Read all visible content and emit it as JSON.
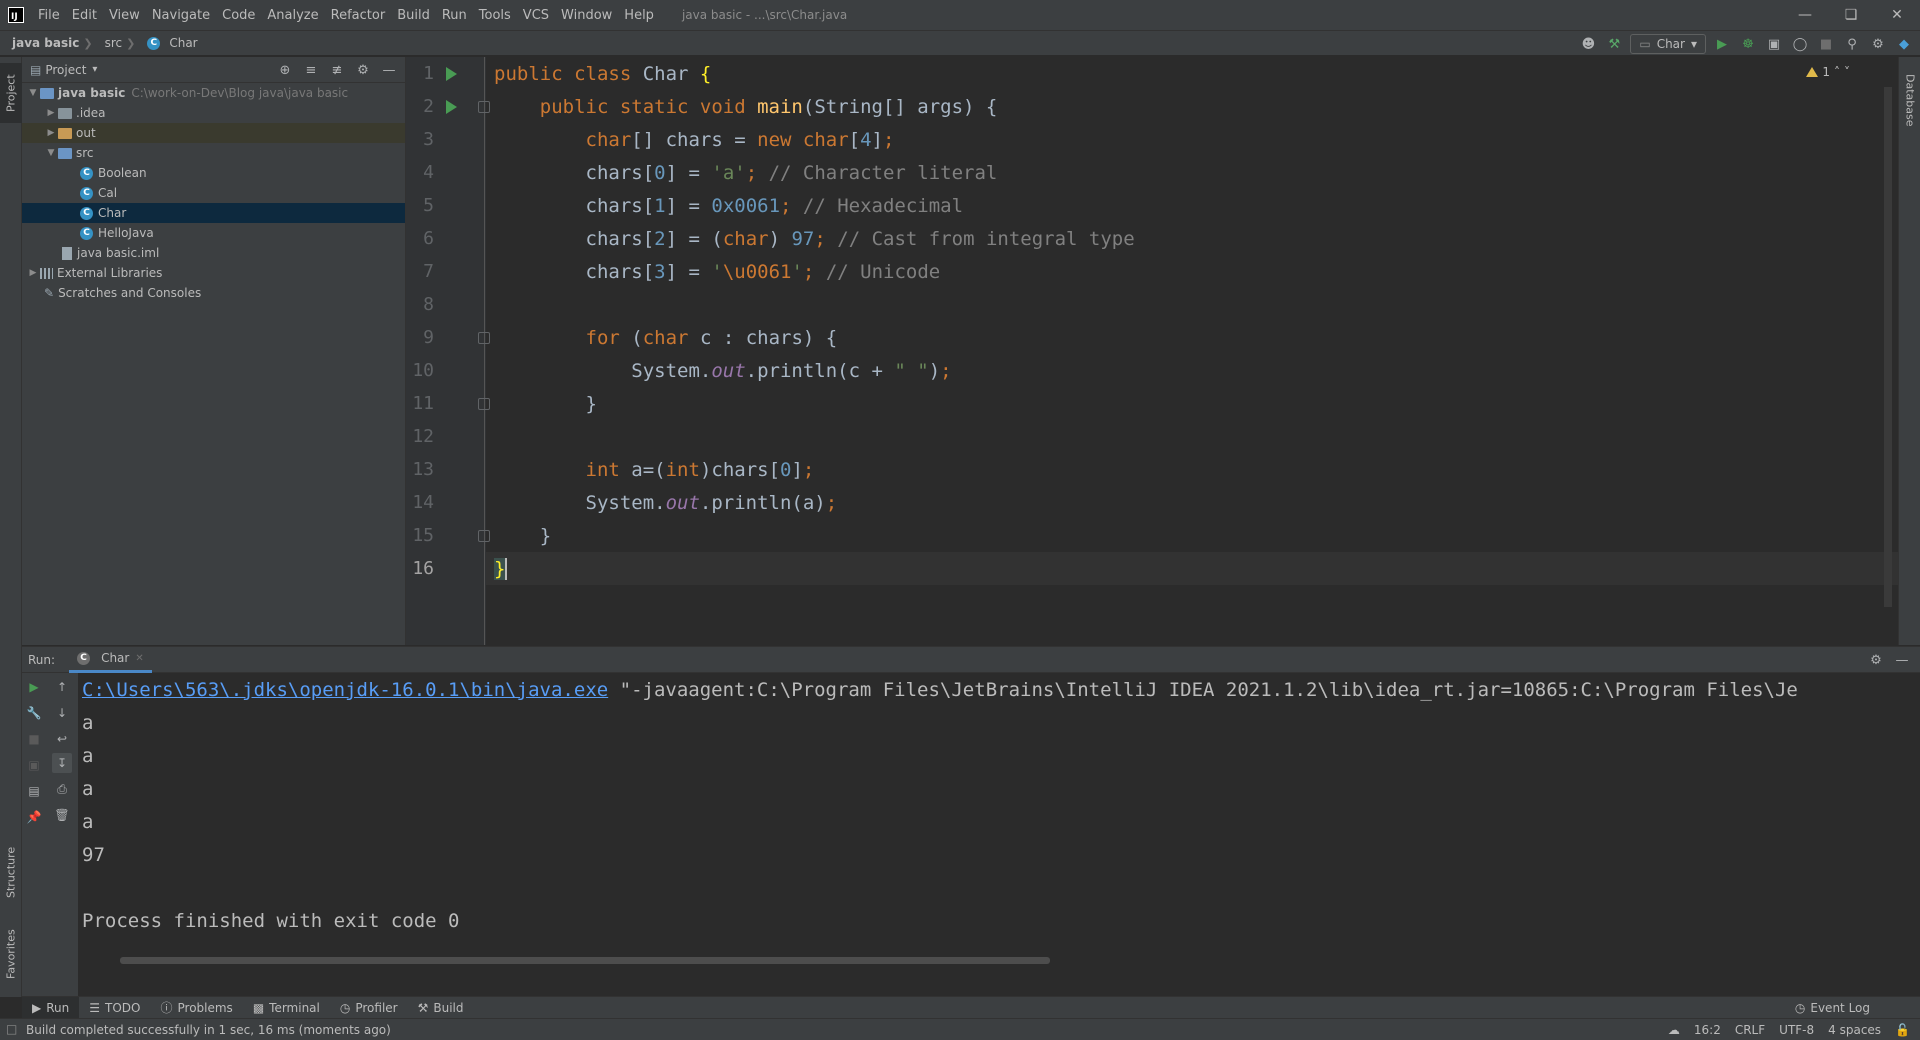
{
  "app": {
    "logo": "IJ",
    "window_title": "java basic - ...\\src\\Char.java",
    "menu": [
      "File",
      "Edit",
      "View",
      "Navigate",
      "Code",
      "Analyze",
      "Refactor",
      "Build",
      "Run",
      "Tools",
      "VCS",
      "Window",
      "Help"
    ]
  },
  "breadcrumb": [
    "java basic",
    "src",
    "Char"
  ],
  "toolbar": {
    "run_config": "Char"
  },
  "side_tabs": {
    "project": "Project",
    "structure": "Structure",
    "favorites": "Favorites",
    "database": "Database"
  },
  "project_panel": {
    "title": "Project",
    "tree": [
      {
        "label": "java basic",
        "hint": "C:\\work-on-Dev\\Blog java\\java basic",
        "kind": "module",
        "depth": 0,
        "expanded": true
      },
      {
        "label": ".idea",
        "kind": "folder",
        "depth": 1,
        "expanded": false
      },
      {
        "label": "out",
        "kind": "folder-excluded",
        "depth": 1,
        "expanded": false
      },
      {
        "label": "src",
        "kind": "folder-source",
        "depth": 1,
        "expanded": true
      },
      {
        "label": "Boolean",
        "kind": "class",
        "depth": 2
      },
      {
        "label": "Cal",
        "kind": "class",
        "depth": 2
      },
      {
        "label": "Char",
        "kind": "class",
        "depth": 2,
        "selected": true
      },
      {
        "label": "HelloJava",
        "kind": "class",
        "depth": 2
      },
      {
        "label": "java basic.iml",
        "kind": "file",
        "depth": 1
      },
      {
        "label": "External Libraries",
        "kind": "library",
        "depth": 0,
        "expanded": false
      },
      {
        "label": "Scratches and Consoles",
        "kind": "scratch",
        "depth": 0
      }
    ]
  },
  "editor": {
    "warnings": "1",
    "current_line": 16,
    "lines": [
      {
        "no": "1",
        "text": "public class Char {"
      },
      {
        "no": "2",
        "text": "    public static void main(String[] args) {"
      },
      {
        "no": "3",
        "text": "        char[] chars = new char[4];"
      },
      {
        "no": "4",
        "text": "        chars[0] = 'a'; // Character literal"
      },
      {
        "no": "5",
        "text": "        chars[1] = 0x0061; // Hexadecimal"
      },
      {
        "no": "6",
        "text": "        chars[2] = (char) 97; // Cast from integral type"
      },
      {
        "no": "7",
        "text": "        chars[3] = '\\u0061'; // Unicode"
      },
      {
        "no": "8",
        "text": ""
      },
      {
        "no": "9",
        "text": "        for (char c : chars) {"
      },
      {
        "no": "10",
        "text": "            System.out.println(c + \" \");"
      },
      {
        "no": "11",
        "text": "        }"
      },
      {
        "no": "12",
        "text": ""
      },
      {
        "no": "13",
        "text": "        int a=(int)chars[0];"
      },
      {
        "no": "14",
        "text": "        System.out.println(a);"
      },
      {
        "no": "15",
        "text": "    }"
      },
      {
        "no": "16",
        "text": "}"
      }
    ]
  },
  "run_panel": {
    "label": "Run:",
    "tab": "Char",
    "command_link": "C:\\Users\\563\\.jdks\\openjdk-16.0.1\\bin\\java.exe",
    "command_rest": " \"-javaagent:C:\\Program Files\\JetBrains\\IntelliJ IDEA 2021.1.2\\lib\\idea_rt.jar=10865:C:\\Program Files\\Je",
    "output": [
      "a",
      "a",
      "a",
      "a",
      "97",
      "",
      "Process finished with exit code 0"
    ]
  },
  "bottom_tabs": [
    "Run",
    "TODO",
    "Problems",
    "Terminal",
    "Profiler",
    "Build"
  ],
  "event_log": "Event Log",
  "status": {
    "message": "Build completed successfully in 1 sec, 16 ms (moments ago)",
    "position": "16:2",
    "line_sep": "CRLF",
    "encoding": "UTF-8",
    "indent": "4 spaces"
  }
}
